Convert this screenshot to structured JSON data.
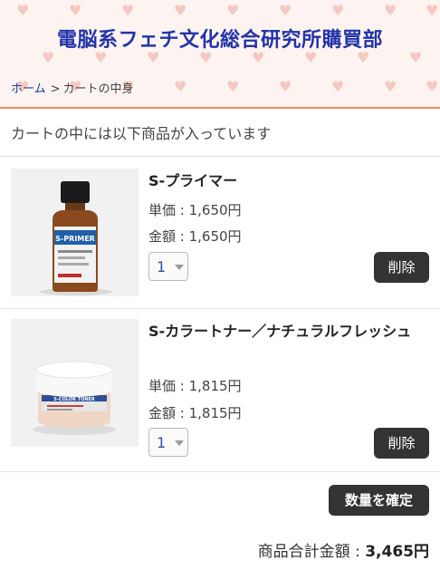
{
  "header": {
    "site_title": "電脳系フェチ文化総合研究所購買部",
    "accent_color": "#f08c55",
    "title_color": "#2233aa"
  },
  "breadcrumb": {
    "home": "ホーム",
    "separator": ">",
    "current": "カートの中身"
  },
  "cart": {
    "intro": "カートの中には以下商品が入っています",
    "items": [
      {
        "name": "S-プライマー",
        "unit_price": "単価 : 1,650円",
        "subtotal": "金額 : 1,650円",
        "quantity": "1",
        "delete_label": "削除",
        "thumb_label": "S-PRIMER"
      },
      {
        "name": "S-カラートナー／ナチュラルフレッシュ",
        "unit_price": "単価 : 1,815円",
        "subtotal": "金額 : 1,815円",
        "quantity": "1",
        "delete_label": "削除",
        "thumb_label": "S-COLOR TONER"
      }
    ],
    "confirm_label": "数量を確定",
    "total_label": "商品合計金額 : ",
    "total_value": "3,465円"
  }
}
